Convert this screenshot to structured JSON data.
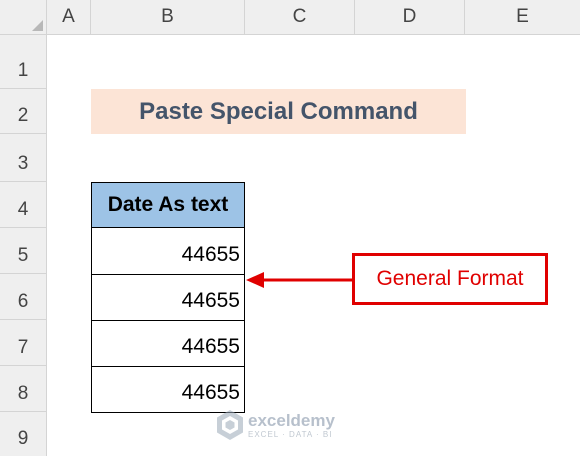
{
  "spreadsheet": {
    "columns": [
      "A",
      "B",
      "C",
      "D",
      "E"
    ],
    "rows": [
      "1",
      "2",
      "3",
      "4",
      "5",
      "6",
      "7",
      "8",
      "9"
    ],
    "title": "Paste Special Command",
    "table": {
      "header": "Date As text",
      "values": [
        "44655",
        "44655",
        "44655",
        "44655"
      ]
    },
    "callout": "General Format"
  },
  "watermark": {
    "brand": "exceldemy",
    "tagline": "EXCEL · DATA · BI"
  },
  "colors": {
    "title_fill": "#fce4d6",
    "title_text": "#44546a",
    "header_fill": "#9dc3e6",
    "callout_red": "#e00000"
  }
}
